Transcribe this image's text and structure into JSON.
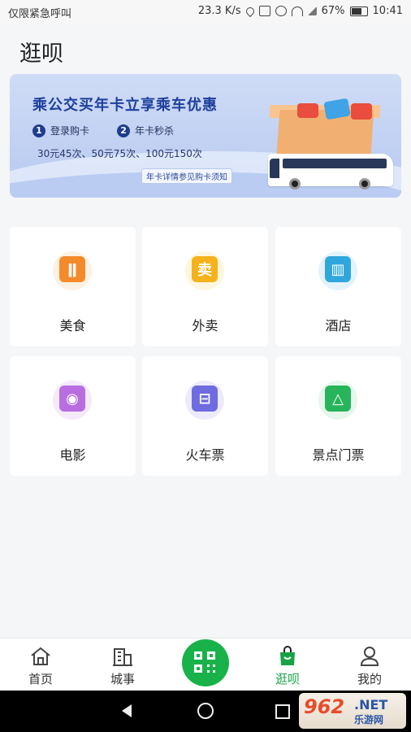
{
  "status_bar": {
    "carrier_text": "仅限紧急呼叫",
    "speed": "23.3 K/s",
    "battery": "67%",
    "time": "10:41",
    "icons": [
      "location-icon",
      "nfc-icon",
      "mute-icon",
      "wifi-icon",
      "signal-icon",
      "battery-icon"
    ]
  },
  "page": {
    "title": "逛呗"
  },
  "banner": {
    "title": "乘公交买年卡立享乘车优惠",
    "steps": [
      {
        "num": "1",
        "label": "登录购卡"
      },
      {
        "num": "2",
        "label": "年卡秒杀"
      }
    ],
    "prices": "30元45次、50元75次、100元150次",
    "note": "年卡详情参见购卡须知"
  },
  "services": [
    {
      "label": "美食",
      "icon": "food-icon",
      "icon_color": "#f58a2b",
      "halo": "#fdf1e4",
      "glyph": "ǁ"
    },
    {
      "label": "外卖",
      "icon": "takeout-icon",
      "icon_color": "#f5b21c",
      "halo": "#fdf6e0",
      "glyph": "卖"
    },
    {
      "label": "酒店",
      "icon": "hotel-icon",
      "icon_color": "#30a7dc",
      "halo": "#e4f3fa",
      "glyph": "▥"
    },
    {
      "label": "电影",
      "icon": "movie-icon",
      "icon_color": "#b86ee0",
      "halo": "#f5eafb",
      "glyph": "◉"
    },
    {
      "label": "火车票",
      "icon": "train-icon",
      "icon_color": "#6f6be0",
      "halo": "#ecebfb",
      "glyph": "⊟"
    },
    {
      "label": "景点门票",
      "icon": "scenic-ticket-icon",
      "icon_color": "#27b45a",
      "halo": "#e6f6ec",
      "glyph": "△"
    }
  ],
  "tabbar": {
    "tabs": [
      {
        "label": "首页",
        "icon": "home-icon",
        "active": false
      },
      {
        "label": "城事",
        "icon": "city-icon",
        "active": false
      },
      {
        "label": "逛呗",
        "icon": "shopping-bag-icon",
        "active": true
      },
      {
        "label": "我的",
        "icon": "profile-icon",
        "active": false
      }
    ],
    "center_icon": "qr-scan-icon",
    "active_color": "#17a344"
  },
  "watermark": {
    "brand": "962",
    "domain": ".NET",
    "sub": "乐游网"
  }
}
